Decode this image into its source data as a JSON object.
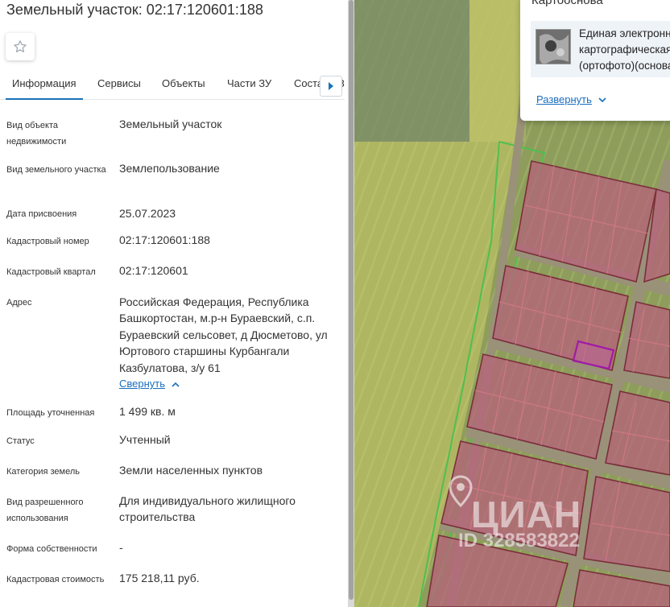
{
  "panel": {
    "title": "Земельный участок: 02:17:120601:188",
    "tabs": [
      "Информация",
      "Сервисы",
      "Объекты",
      "Части ЗУ",
      "Состав ЕЗП"
    ],
    "active_tab": "Информация",
    "rows": [
      {
        "label": "Вид объекта недвижимости",
        "value": "Земельный участок"
      },
      {
        "label": "Вид земельного участка",
        "value": "Землепользование"
      },
      {
        "label": "Дата присвоения",
        "value": "25.07.2023"
      },
      {
        "label": "Кадастровый номер",
        "value": "02:17:120601:188"
      },
      {
        "label": "Кадастровый квартал",
        "value": "02:17:120601"
      },
      {
        "label": "Адрес",
        "value": "Российская Федерация, Республика Башкортостан, м.р-н Бураевский, с.п. Бураевский сельсовет, д Дюсметово, ул Юртового старшины Курбангали Казбулатова, з/у 61"
      },
      {
        "label": "Площадь уточненная",
        "value": "1 499 кв. м"
      },
      {
        "label": "Статус",
        "value": "Учтенный"
      },
      {
        "label": "Категория земель",
        "value": "Земли населенных пунктов"
      },
      {
        "label": "Вид разрешенного использования",
        "value": "Для индивидуального жилищного строительства"
      },
      {
        "label": "Форма собственности",
        "value": "-"
      },
      {
        "label": "Кадастровая стоимость",
        "value": "175 218,11 руб."
      }
    ],
    "collapse_label": "Свернуть"
  },
  "layer_card": {
    "title": "Картооснова",
    "text_lines": [
      "Единая электронная",
      "картографическая",
      "(ортофото)(основа)"
    ],
    "expand_label": "Развернуть"
  },
  "watermark": {
    "brand": "ЦИАН",
    "id": "ID 328583822"
  },
  "colors": {
    "accent": "#1a73b7",
    "link": "#1a6fbf",
    "parcel_fill": "#b5647a",
    "parcel_border": "#8a2f3a",
    "selected_parcel": "#a11aa6",
    "zone_green": "#4fbf4f",
    "zone_yellow": "#d8d46a"
  },
  "icons": [
    "star-icon",
    "chevron-right-icon",
    "chevron-up-icon",
    "chevron-down-icon",
    "location-pin-icon"
  ]
}
